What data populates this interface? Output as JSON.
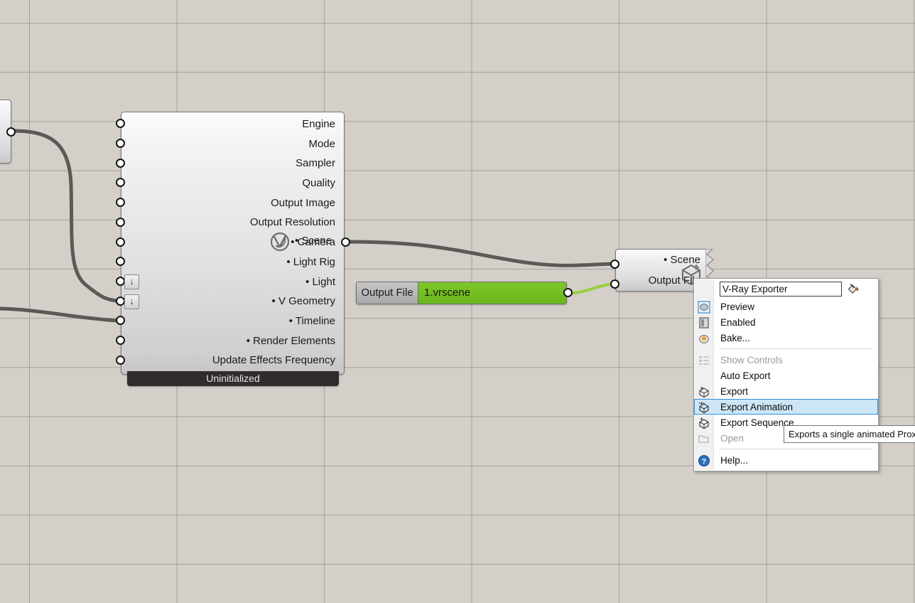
{
  "canvas": {
    "background_color": "#d4cfc8",
    "grid_line_color": "#6e6962"
  },
  "main_node": {
    "status": "Uninitialized",
    "scene_output_label": "• Scene",
    "logo_icon": "vray-logo-icon",
    "parameters": [
      {
        "label": "Engine",
        "has_arrow": false
      },
      {
        "label": "Mode",
        "has_arrow": false
      },
      {
        "label": "Sampler",
        "has_arrow": false
      },
      {
        "label": "Quality",
        "has_arrow": false
      },
      {
        "label": "Output Image",
        "has_arrow": false
      },
      {
        "label": "Output Resolution",
        "has_arrow": false
      },
      {
        "label": "• Camera",
        "has_arrow": false
      },
      {
        "label": "• Light Rig",
        "has_arrow": false
      },
      {
        "label": "• Light",
        "has_arrow": true
      },
      {
        "label": "• V Geometry",
        "has_arrow": true
      },
      {
        "label": "• Timeline",
        "has_arrow": false
      },
      {
        "label": "• Render Elements",
        "has_arrow": false
      },
      {
        "label": "Update Effects Frequency",
        "has_arrow": false
      }
    ]
  },
  "output_file_node": {
    "label": "Output File",
    "value": "1.vrscene",
    "value_color": "#76bf25"
  },
  "exporter_node": {
    "rows": [
      "• Scene",
      "Output File"
    ],
    "icon": "cube-icon"
  },
  "context_menu": {
    "name_value": "V-Ray Exporter",
    "bucket_icon": "paint-bucket-icon",
    "items": [
      {
        "label": "Preview",
        "icon": "preview-icon",
        "disabled": false,
        "selected": false,
        "separator_after": false
      },
      {
        "label": "Enabled",
        "icon": "enabled-icon",
        "disabled": false,
        "selected": false,
        "separator_after": false
      },
      {
        "label": "Bake...",
        "icon": "bake-icon",
        "disabled": false,
        "selected": false,
        "separator_after": true
      },
      {
        "label": "Show Controls",
        "icon": "show-controls-icon",
        "disabled": true,
        "selected": false,
        "separator_after": false
      },
      {
        "label": "Auto Export",
        "icon": "none",
        "disabled": false,
        "selected": false,
        "separator_after": false
      },
      {
        "label": "Export",
        "icon": "export-icon",
        "disabled": false,
        "selected": false,
        "separator_after": false
      },
      {
        "label": "Export Animation",
        "icon": "export-animation-icon",
        "disabled": false,
        "selected": true,
        "separator_after": false
      },
      {
        "label": "Export Sequence",
        "icon": "export-sequence-icon",
        "disabled": false,
        "selected": false,
        "separator_after": false
      },
      {
        "label": "Open",
        "icon": "folder-open-icon",
        "disabled": true,
        "selected": false,
        "separator_after": true
      },
      {
        "label": "Help...",
        "icon": "help-icon",
        "disabled": false,
        "selected": false,
        "separator_after": false
      }
    ],
    "highlight_fill": "#cde6f7",
    "highlight_border": "#2e90d8"
  },
  "tooltip": {
    "text": "Exports a single animated Proxy M"
  }
}
